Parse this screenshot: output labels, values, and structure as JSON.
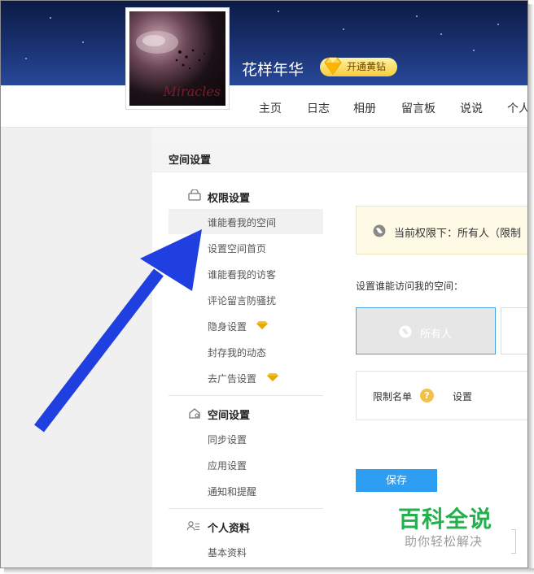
{
  "profile": {
    "username": "花样年华",
    "avatar_caption": "Miracles",
    "vip_button": "开通黄钻"
  },
  "nav": {
    "items": [
      "主页",
      "日志",
      "相册",
      "留言板",
      "说说",
      "个人"
    ]
  },
  "panel": {
    "title": "空间设置"
  },
  "sidebar": {
    "sections": [
      {
        "title": "权限设置",
        "icon": "lock-icon",
        "items": [
          {
            "label": "谁能看我的空间",
            "active": true
          },
          {
            "label": "设置空间首页"
          },
          {
            "label": "谁能看我的访客"
          },
          {
            "label": "评论留言防骚扰"
          },
          {
            "label": "隐身设置",
            "vip": true
          },
          {
            "label": "封存我的动态"
          },
          {
            "label": "去广告设置",
            "vip": true
          }
        ]
      },
      {
        "title": "空间设置",
        "icon": "house-gear-icon",
        "items": [
          {
            "label": "同步设置"
          },
          {
            "label": "应用设置"
          },
          {
            "label": "通知和提醒"
          }
        ]
      },
      {
        "title": "个人资料",
        "icon": "person-card-icon",
        "items": [
          {
            "label": "基本资料"
          }
        ]
      }
    ]
  },
  "main": {
    "notice": "当前权限下：所有人（限制",
    "access_label": "设置谁能访问我的空间：",
    "option_all": "所有人",
    "restrict_label": "限制名单",
    "help_glyph": "?",
    "set_link": "设置",
    "save_button": "保存"
  },
  "watermark": {
    "title": "百科全说",
    "subtitle": "助你轻松解决"
  },
  "colors": {
    "accent_blue": "#2e9ef2",
    "arrow_blue": "#1f3fe0",
    "vip_gold": "#f6cc3a",
    "watermark_green": "#22b14c"
  }
}
